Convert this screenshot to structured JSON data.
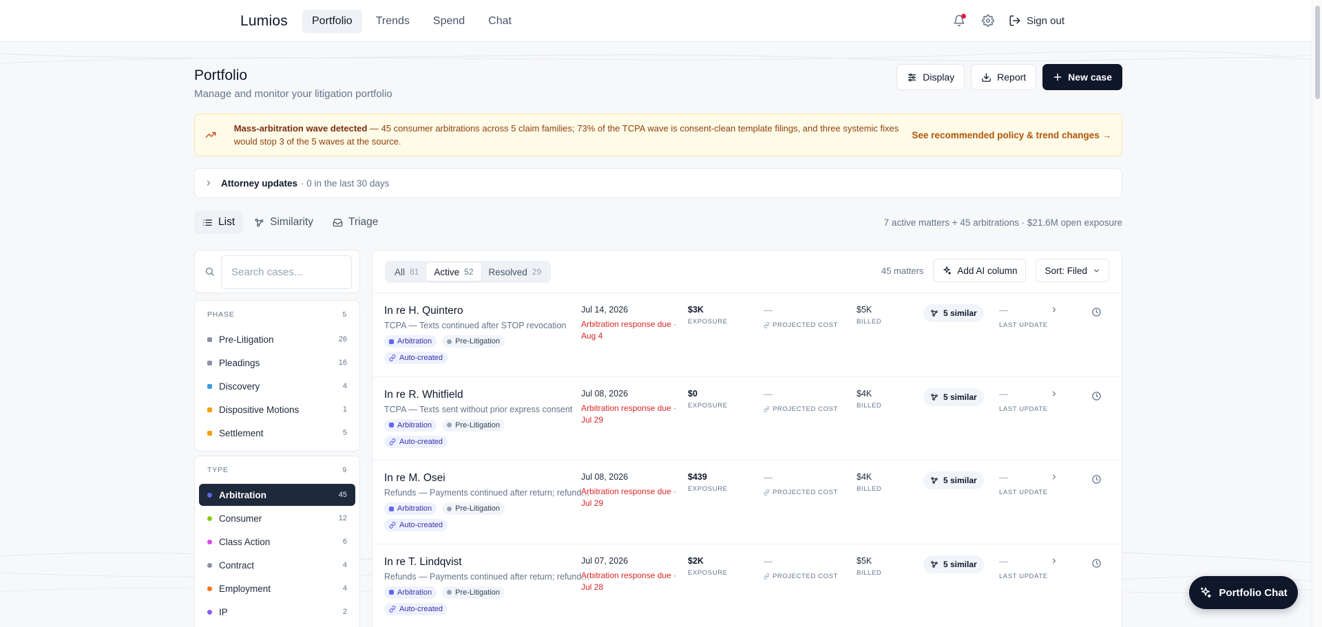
{
  "app": {
    "brand": "Lumios",
    "nav": [
      {
        "label": "Portfolio",
        "active": true
      },
      {
        "label": "Trends",
        "active": false
      },
      {
        "label": "Spend",
        "active": false
      },
      {
        "label": "Chat",
        "active": false
      }
    ],
    "sign_out": "Sign out"
  },
  "page": {
    "title": "Portfolio",
    "subtitle": "Manage and monitor your litigation portfolio",
    "actions": {
      "display": "Display",
      "report": "Report",
      "new_case": "New case"
    }
  },
  "alert": {
    "strong": "Mass-arbitration wave detected",
    "body": " — 45 consumer arbitrations across 5 claim families; 73% of the TCPA wave is consent-clean template filings, and three systemic fixes would stop 3 of the 5 waves at the source.",
    "link": "See recommended policy & trend changes →"
  },
  "updates": {
    "label": "Attorney updates",
    "detail": "· 0 in the last 30 days"
  },
  "views": {
    "tabs": [
      {
        "label": "List"
      },
      {
        "label": "Similarity"
      },
      {
        "label": "Triage"
      }
    ],
    "summary": "7 active matters + 45 arbitrations · $21.6M open exposure"
  },
  "search": {
    "placeholder": "Search cases..."
  },
  "facets": {
    "phase": {
      "title": "PHASE",
      "count": "5",
      "items": [
        {
          "label": "Pre-Litigation",
          "count": "26",
          "color": "#8a94a6"
        },
        {
          "label": "Pleadings",
          "count": "16",
          "color": "#8a94a6"
        },
        {
          "label": "Discovery",
          "count": "4",
          "color": "#3b9ee6"
        },
        {
          "label": "Dispositive Motions",
          "count": "1",
          "color": "#f59e0b"
        },
        {
          "label": "Settlement",
          "count": "5",
          "color": "#f59e0b"
        }
      ]
    },
    "type": {
      "title": "TYPE",
      "count": "9",
      "items": [
        {
          "label": "Arbitration",
          "count": "45",
          "color": "#6366f1",
          "selected": true
        },
        {
          "label": "Consumer",
          "count": "12",
          "color": "#84cc16"
        },
        {
          "label": "Class Action",
          "count": "6",
          "color": "#d946ef"
        },
        {
          "label": "Contract",
          "count": "4",
          "color": "#8a94a6"
        },
        {
          "label": "Employment",
          "count": "4",
          "color": "#f97316"
        },
        {
          "label": "IP",
          "count": "2",
          "color": "#8b5cf6"
        }
      ]
    }
  },
  "table": {
    "segments": [
      {
        "label": "All",
        "count": "81",
        "active": false
      },
      {
        "label": "Active",
        "count": "52",
        "active": true
      },
      {
        "label": "Resolved",
        "count": "29",
        "active": false
      }
    ],
    "matters_count": "45 matters",
    "add_ai_column": "Add AI column",
    "sort": "Sort: Filed",
    "labels": {
      "exposure": "EXPOSURE",
      "projected_cost": "PROJECTED COST",
      "billed": "BILLED",
      "last_update": "LAST UPDATE",
      "dash": "—"
    },
    "rows": [
      {
        "name": "In re H. Quintero",
        "desc": "TCPA — Texts continued after STOP revocation",
        "type_chip": "Arbitration",
        "phase_chip": "Pre-Litigation",
        "auto_chip": "Auto-created",
        "date": "Jul 14, 2026",
        "due": "Arbitration response due · Aug 4",
        "exposure": "$3K",
        "billed": "$5K",
        "similar": "5 similar"
      },
      {
        "name": "In re R. Whitfield",
        "desc": "TCPA — Texts sent without prior express consent",
        "type_chip": "Arbitration",
        "phase_chip": "Pre-Litigation",
        "auto_chip": "Auto-created",
        "date": "Jul 08, 2026",
        "due": "Arbitration response due · Jul 29",
        "exposure": "$0",
        "billed": "$4K",
        "similar": "5 similar"
      },
      {
        "name": "In re M. Osei",
        "desc": "Refunds — Payments continued after return; refund not issued",
        "type_chip": "Arbitration",
        "phase_chip": "Pre-Litigation",
        "auto_chip": "Auto-created",
        "date": "Jul 08, 2026",
        "due": "Arbitration response due · Jul 29",
        "exposure": "$439",
        "billed": "$4K",
        "similar": "5 similar"
      },
      {
        "name": "In re T. Lindqvist",
        "desc": "Refunds — Payments continued after return; refund not issued",
        "type_chip": "Arbitration",
        "phase_chip": "Pre-Litigation",
        "auto_chip": "Auto-created",
        "date": "Jul 07, 2026",
        "due": "Arbitration response due · Jul 28",
        "exposure": "$2K",
        "billed": "$5K",
        "similar": "5 similar"
      }
    ]
  },
  "chat_fab": "Portfolio Chat",
  "colors": {
    "primary": "#0f172a",
    "alert_bg": "#fefbe8",
    "alert_text": "#92400e",
    "due": "#dc2626",
    "notification": "#e11d48"
  },
  "icons": [
    "bell-icon",
    "gear-icon",
    "sign-out-icon",
    "sliders-icon",
    "download-icon",
    "plus-icon",
    "trend-icon",
    "chevron-right-icon",
    "list-icon",
    "similarity-icon",
    "inbox-icon",
    "search-icon",
    "sparkle-icon",
    "chevron-down-icon",
    "link-icon",
    "clock-icon"
  ]
}
